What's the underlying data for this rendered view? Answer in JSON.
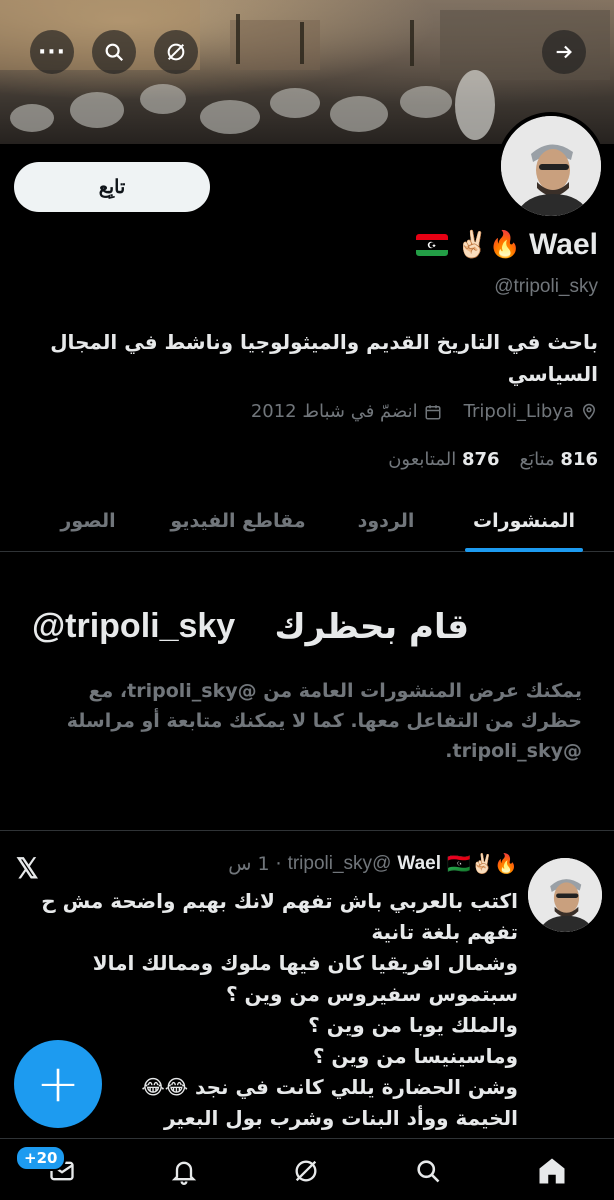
{
  "header": {
    "back_icon": "arrow-right-icon",
    "more_icon": "more-horizontal-icon",
    "search_icon": "search-icon",
    "grok_icon": "grok-icon"
  },
  "profile": {
    "follow_label": "تابِع",
    "name": "Wael",
    "name_emojis": "🔥✌🏻",
    "flag": "🇱🇾",
    "handle": "@tripoli_sky",
    "bio": "باحث في التاريخ القديم والميثولوجيا وناشط في المجال السياسي",
    "location": "Tripoli_Libya",
    "joined": "انضمّ في شباط 2012",
    "following_count": "816",
    "following_label": "متابَع",
    "followers_count": "876",
    "followers_label": "المتابعون"
  },
  "tabs": [
    {
      "label": "المنشورات",
      "active": true
    },
    {
      "label": "الردود",
      "active": false
    },
    {
      "label": "مقاطع الفيديو",
      "active": false
    },
    {
      "label": "الصور",
      "active": false
    }
  ],
  "blocked": {
    "title": "قام بحظرك",
    "handle": "@tripoli_sky",
    "message": "يمكنك عرض المنشورات العامة من @tripoli_sky، مع حظرك من التفاعل معها. كما لا يمكنك متابعة أو مراسلة @tripoli_sky."
  },
  "tweet": {
    "name": "Wael",
    "emojis": "🔥✌🏻🇱🇾",
    "handle": "@tripoli_sky",
    "dot": "·",
    "time": "1 س",
    "lines": [
      "اكتب بالعربي باش تفهم لانك بهيم واضحة مش ح",
      "تفهم بلغة تانية",
      "وشمال افريقيا كان فيها ملوك وممالك امالا",
      "سبتموس سفيروس من وين ؟",
      "والملك يوبا من وين ؟",
      "وماسينيسا من وين ؟",
      "وشن الحضارة يللي كانت في نجد 😂😂",
      "الخيمة ووأد البنات وشرب بول البعير"
    ]
  },
  "fab_label": "+",
  "bottom_nav": {
    "badge": "+20",
    "items": [
      "home-icon",
      "search-icon",
      "grok-icon",
      "notifications-icon",
      "messages-icon"
    ]
  },
  "colors": {
    "accent": "#1d9bf0",
    "background": "#000000",
    "muted": "#71767b",
    "text": "#e7e9ea"
  }
}
